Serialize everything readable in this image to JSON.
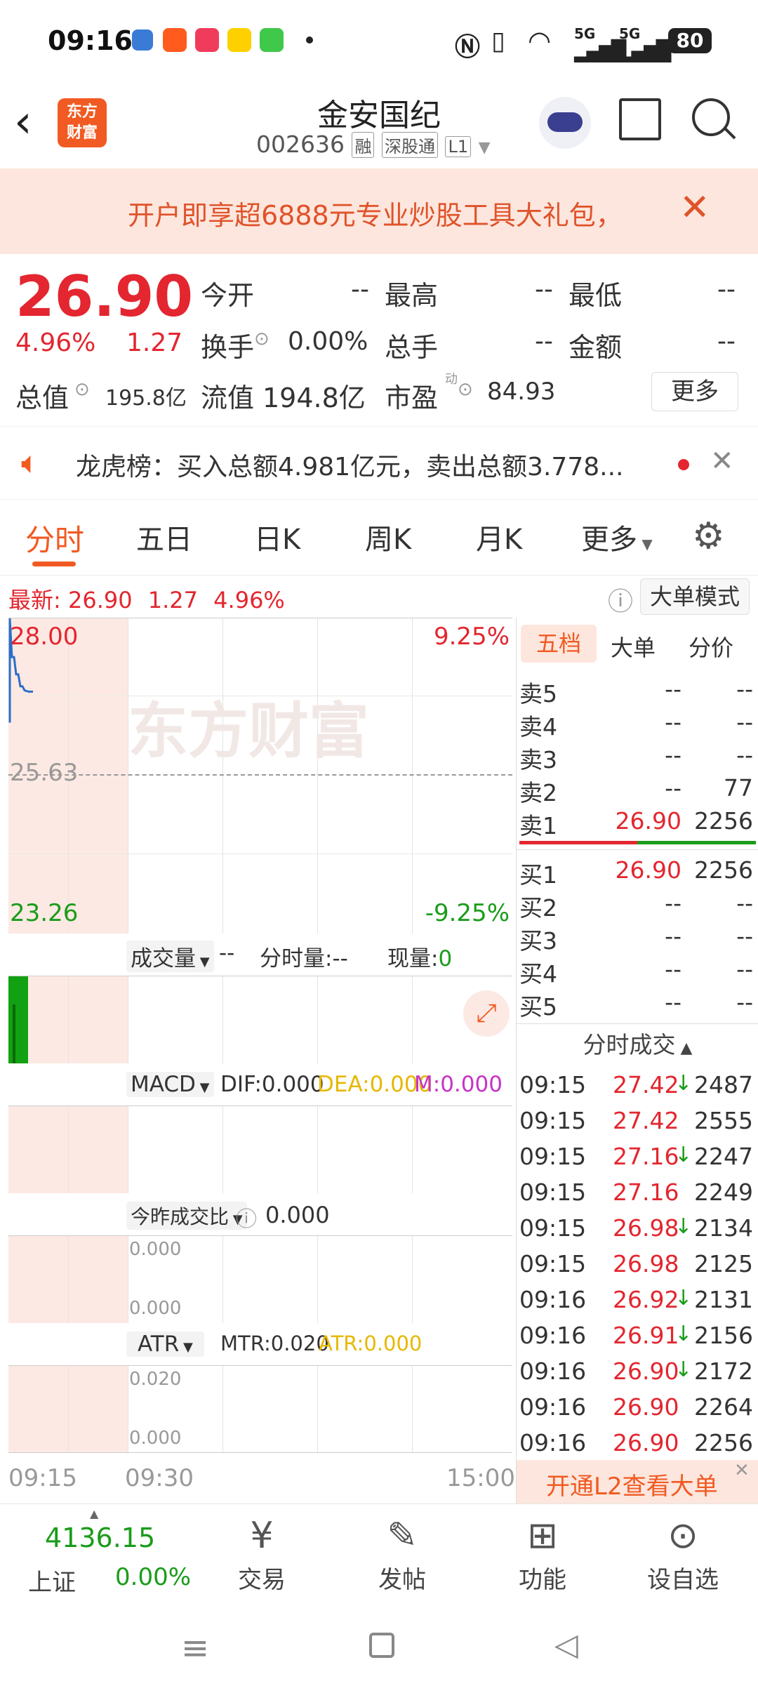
{
  "status": {
    "time": "09:16",
    "battery": "80",
    "sig1": "5G",
    "sig2": "5G"
  },
  "nav": {
    "logo_line1": "东方",
    "logo_line2": "财富",
    "title": "金安国纪",
    "code": "002636",
    "badge1": "融",
    "badge2": "深股通",
    "badge3": "L1"
  },
  "banner": {
    "text": "开户即享超6888元专业炒股工具大礼包，"
  },
  "quote": {
    "price": "26.90",
    "pct": "4.96%",
    "chg": "1.27",
    "open_label": "今开",
    "open": "--",
    "high_label": "最高",
    "high": "--",
    "low_label": "最低",
    "low": "--",
    "turnover_label": "换手",
    "turnover": "0.00%",
    "volume_label": "总手",
    "volume": "--",
    "amount_label": "金额",
    "amount": "--",
    "mcap_label": "总值",
    "mcap": "195.8亿",
    "float_label": "流值",
    "float_cap": "194.8亿",
    "pe_label": "市盈",
    "pe_sup": "动",
    "pe": "84.93",
    "more": "更多"
  },
  "notice": {
    "text": "龙虎榜：买入总额4.981亿元，卖出总额3.778..."
  },
  "tabs": [
    "分时",
    "五日",
    "日K",
    "周K",
    "月K",
    "更多"
  ],
  "latest": {
    "label": "最新:",
    "price": "26.90",
    "chg": "1.27",
    "pct": "4.96%",
    "mode_btn": "大单模式"
  },
  "chart": {
    "watermark": "东方财富",
    "y_high": "28.00",
    "y_mid": "25.63",
    "y_low": "23.26",
    "pct_high": "9.25%",
    "pct_low": "-9.25%",
    "vol_sel": "成交量",
    "vol_dash": "--",
    "vol_fs_label": "分时量:--",
    "vol_now_label": "现量:",
    "vol_now": "0",
    "macd_sel": "MACD",
    "dif": "DIF:0.000",
    "dea": "DEA:0.000",
    "m": "M:0.000",
    "ratio_sel": "今昨成交比",
    "ratio": "0.000",
    "ratio_top": "0.000",
    "ratio_bot": "0.000",
    "atr_sel": "ATR",
    "mtr": "MTR:0.020",
    "atr": "ATR:0.000",
    "atr_top": "0.020",
    "atr_bot": "0.000",
    "t_start": "09:15",
    "t_mid": "09:30",
    "t_end": "15:00",
    "price_series": [
      28.0,
      27.42,
      27.42,
      27.16,
      27.16,
      26.98,
      26.98,
      26.92,
      26.91,
      26.9,
      26.9,
      26.9
    ]
  },
  "orderbook": {
    "tabs": [
      "五档",
      "大单",
      "分价"
    ],
    "sells": [
      {
        "label": "卖5",
        "price": "--",
        "vol": "--"
      },
      {
        "label": "卖4",
        "price": "--",
        "vol": "--"
      },
      {
        "label": "卖3",
        "price": "--",
        "vol": "--"
      },
      {
        "label": "卖2",
        "price": "--",
        "vol": "77"
      },
      {
        "label": "卖1",
        "price": "26.90",
        "vol": "2256"
      }
    ],
    "buys": [
      {
        "label": "买1",
        "price": "26.90",
        "vol": "2256"
      },
      {
        "label": "买2",
        "price": "--",
        "vol": "--"
      },
      {
        "label": "买3",
        "price": "--",
        "vol": "--"
      },
      {
        "label": "买4",
        "price": "--",
        "vol": "--"
      },
      {
        "label": "买5",
        "price": "--",
        "vol": "--"
      }
    ],
    "trades_title": "分时成交",
    "trades": [
      {
        "t": "09:15",
        "p": "27.42",
        "a": "↓",
        "v": "2487"
      },
      {
        "t": "09:15",
        "p": "27.42",
        "a": "",
        "v": "2555"
      },
      {
        "t": "09:15",
        "p": "27.16",
        "a": "↓",
        "v": "2247"
      },
      {
        "t": "09:15",
        "p": "27.16",
        "a": "",
        "v": "2249"
      },
      {
        "t": "09:15",
        "p": "26.98",
        "a": "↓",
        "v": "2134"
      },
      {
        "t": "09:15",
        "p": "26.98",
        "a": "",
        "v": "2125"
      },
      {
        "t": "09:16",
        "p": "26.92",
        "a": "↓",
        "v": "2131"
      },
      {
        "t": "09:16",
        "p": "26.91",
        "a": "↓",
        "v": "2156"
      },
      {
        "t": "09:16",
        "p": "26.90",
        "a": "↓",
        "v": "2172"
      },
      {
        "t": "09:16",
        "p": "26.90",
        "a": "",
        "v": "2264"
      },
      {
        "t": "09:16",
        "p": "26.90",
        "a": "",
        "v": "2256"
      }
    ],
    "l2": "开通L2查看大单"
  },
  "bottom": {
    "index_value": "4136.15",
    "index_name": "上证",
    "index_pct": "0.00%",
    "trade": "交易",
    "post": "发帖",
    "func": "功能",
    "addfav": "设自选"
  }
}
